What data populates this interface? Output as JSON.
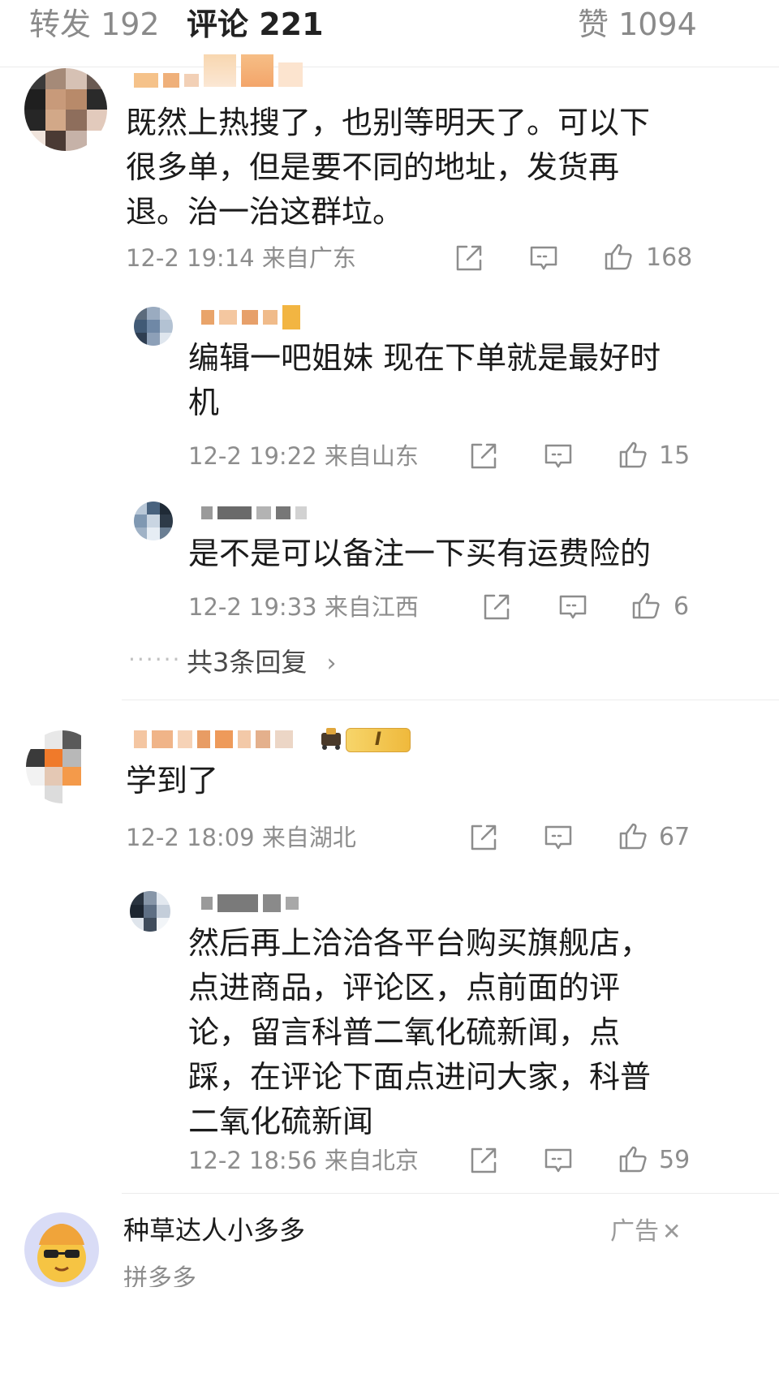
{
  "tabs": {
    "repost": "转发 192",
    "comments": "评论 221",
    "likes": "赞 1094"
  },
  "comments": [
    {
      "text": "既然上热搜了，也别等明天了。可以下很多单，但是要不同的地址，发货再退。治一治这群垃。",
      "time": "12-2 19:14",
      "location": "来自广东",
      "likes": "168",
      "replies": [
        {
          "text": "编辑一吧姐妹 现在下单就是最好时机",
          "time": "12-2 19:22",
          "location": "来自山东",
          "likes": "15"
        },
        {
          "text": "是不是可以备注一下买有运费险的",
          "time": "12-2 19:33",
          "location": "来自江西",
          "likes": "6"
        }
      ],
      "more_replies": "共3条回复"
    },
    {
      "text": "学到了",
      "badge": "I",
      "time": "12-2 18:09",
      "location": "来自湖北",
      "likes": "67",
      "replies": [
        {
          "text": "然后再上洽洽各平台购买旗舰店，点进商品，评论区，点前面的评论，留言科普二氧化硫新闻，点踩，在评论下面点进问大家，科普二氧化硫新闻",
          "time": "12-2 18:56",
          "location": "来自北京",
          "likes": "59"
        }
      ]
    }
  ],
  "ad": {
    "name": "种草达人小多多",
    "label": "广告",
    "close": "✕",
    "subtitle": "拼多多"
  },
  "icons": [
    "repost-icon",
    "comment-icon",
    "like-icon",
    "chevron-right-icon",
    "close-icon"
  ],
  "colors": {
    "text": "#1b1b1b",
    "meta": "#8d8d8d",
    "badge": "#efb93c"
  }
}
